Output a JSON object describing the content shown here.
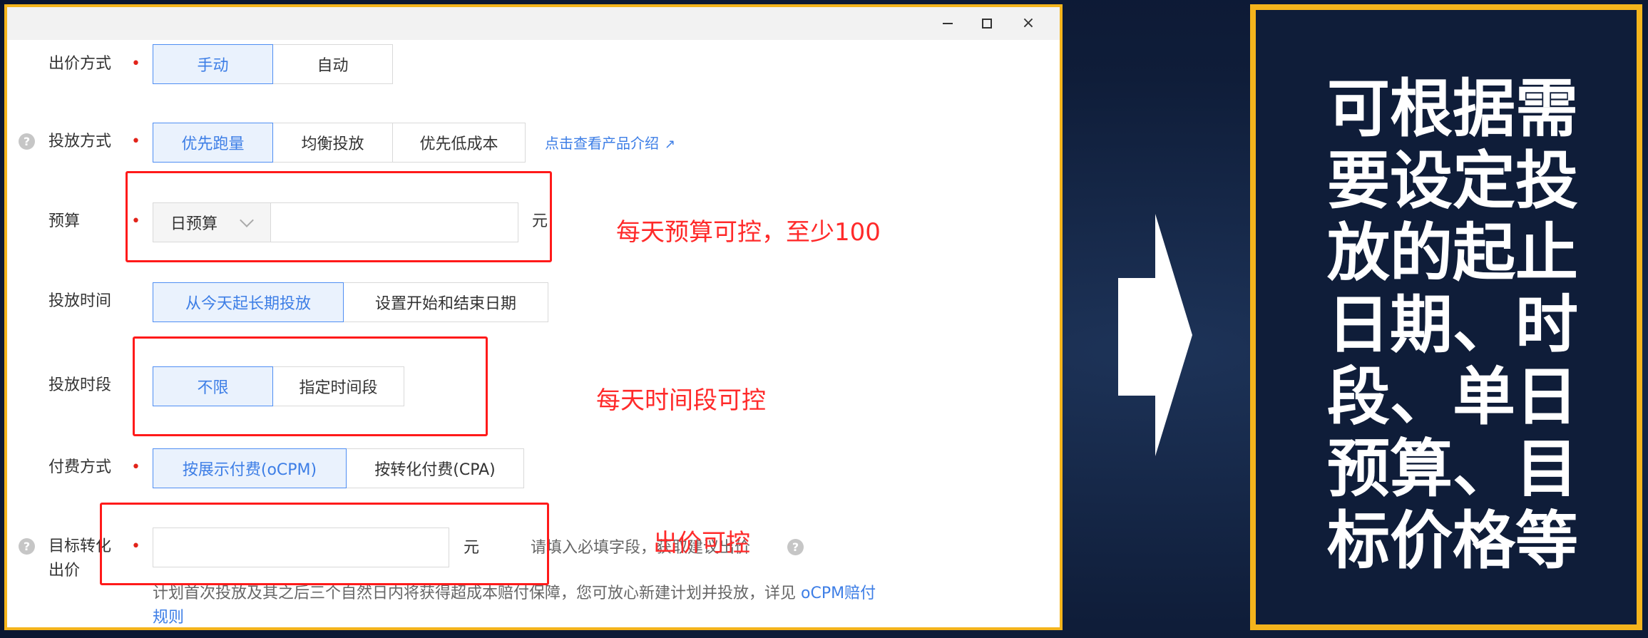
{
  "window": {
    "controls": {
      "minimize": "minimize-icon",
      "maximize": "maximize-icon",
      "close": "×"
    }
  },
  "form": {
    "bid_method": {
      "label": "出价方式",
      "options": [
        "手动",
        "自动"
      ],
      "selected": "手动"
    },
    "delivery_method": {
      "label": "投放方式",
      "options": [
        "优先跑量",
        "均衡投放",
        "优先低成本"
      ],
      "selected": "优先跑量",
      "link": "点击查看产品介绍"
    },
    "budget": {
      "label": "预算",
      "type_select": "日预算",
      "value": "",
      "unit": "元"
    },
    "delivery_time": {
      "label": "投放时间",
      "options": [
        "从今天起长期投放",
        "设置开始和结束日期"
      ],
      "selected": "从今天起长期投放"
    },
    "delivery_period": {
      "label": "投放时段",
      "options": [
        "不限",
        "指定时间段"
      ],
      "selected": "不限"
    },
    "payment_method": {
      "label": "付费方式",
      "options": [
        "按展示付费(oCPM)",
        "按转化付费(CPA)"
      ],
      "selected": "按展示付费(oCPM)"
    },
    "target_bid": {
      "label_line1": "目标转化",
      "label_line2": "出价",
      "value": "",
      "unit": "元",
      "hint": "请填入必填字段，获取建议出价"
    },
    "note": {
      "text": "计划首次投放及其之后三个自然日内将获得超成本赔付保障，您可放心新建计划并投放，详见 ",
      "link_part1": "oCPM赔付",
      "link_part2": "规则"
    }
  },
  "annotations": {
    "budget": "每天预算可控，至少100",
    "period": "每天时间段可控",
    "bid": "出价可控"
  },
  "panel": {
    "text": "可根据需要设定投放的起止日期、时段、单日预算、目标价格等"
  },
  "colors": {
    "accent_blue": "#3d7ee6",
    "annotation_red": "#ff2a2a",
    "frame_gold": "#f4b41c",
    "background_navy": "#0f1d39"
  }
}
